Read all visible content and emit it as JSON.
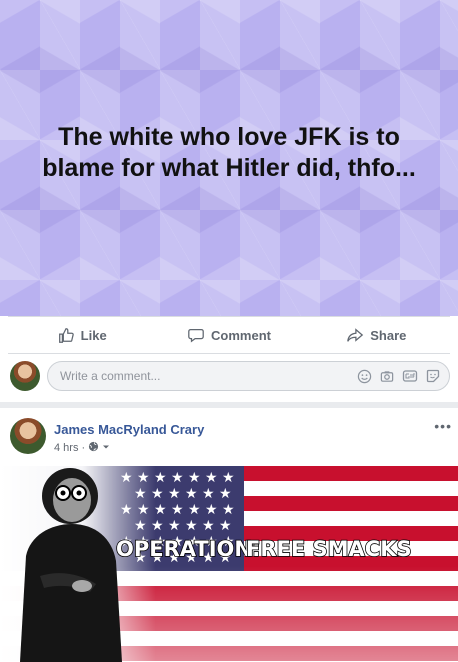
{
  "post1": {
    "text": "The white who love JFK is to blame for what Hitler did, thfo...",
    "actions": {
      "like": "Like",
      "comment": "Comment",
      "share": "Share"
    },
    "comment_placeholder": "Write a comment..."
  },
  "post2": {
    "author": "James MacRyland Crary",
    "time": "4 hrs",
    "separator": "·",
    "meme": {
      "text_left": "OPERATION:",
      "text_right": "FREE SMACKS"
    }
  },
  "colors": {
    "link": "#385898",
    "background_purple": "#b9b1f0",
    "flag_red": "#c8102e",
    "flag_blue": "#3c3b6e"
  }
}
